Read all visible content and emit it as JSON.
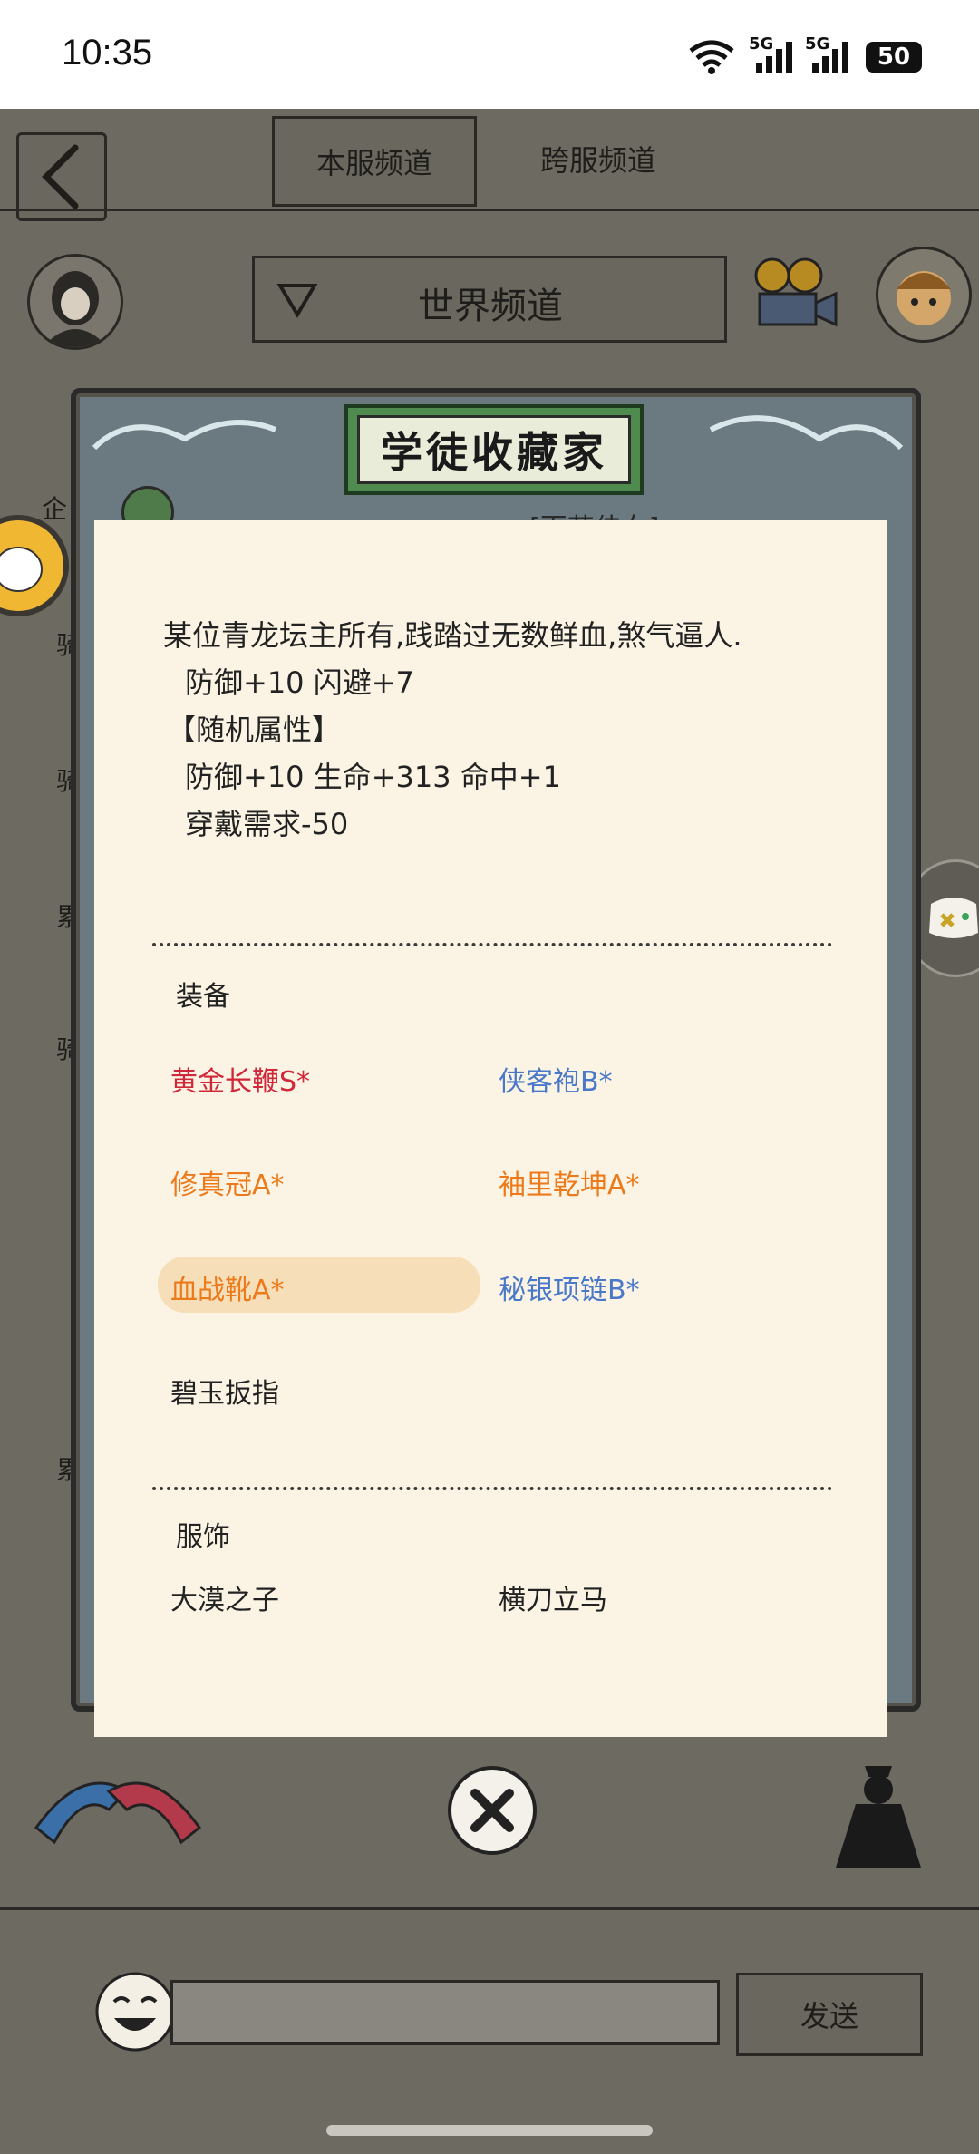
{
  "status_bar": {
    "time": "10:35",
    "signal1": "5G",
    "signal2": "5G",
    "battery": "50"
  },
  "header": {
    "tabs": [
      {
        "label": "本服频道",
        "active": true
      },
      {
        "label": "跨服频道",
        "active": false
      }
    ],
    "channel_selector": "世界频道"
  },
  "side_fragments": [
    "企",
    "骑",
    "骑",
    "累",
    "骑",
    "累"
  ],
  "modal": {
    "title": "学徒收藏家",
    "partial_header": "[百花佳女]",
    "description": "某位青龙坛主所有,践踏过无数鲜血,煞气逼人.",
    "base_stats": "防御+10 闪避+7",
    "random_attr_label": "【随机属性】",
    "random_stats": "防御+10 生命+313 命中+1",
    "wear_requirement": "穿戴需求-50",
    "equipment_label": "装备",
    "equipment": [
      {
        "name": "黄金长鞭S*",
        "color": "#d0283a"
      },
      {
        "name": "侠客袍B*",
        "color": "#4a78c8"
      },
      {
        "name": "修真冠A*",
        "color": "#ec7a1a"
      },
      {
        "name": "袖里乾坤A*",
        "color": "#ec7a1a"
      },
      {
        "name": "血战靴A*",
        "color": "#ec7a1a"
      },
      {
        "name": "秘银项链B*",
        "color": "#4a78c8"
      },
      {
        "name": "碧玉扳指",
        "color": "#222222"
      }
    ],
    "clothing_label": "服饰",
    "clothing": [
      "大漠之子",
      "横刀立马"
    ]
  },
  "chat": {
    "send_label": "发送",
    "input_value": ""
  }
}
